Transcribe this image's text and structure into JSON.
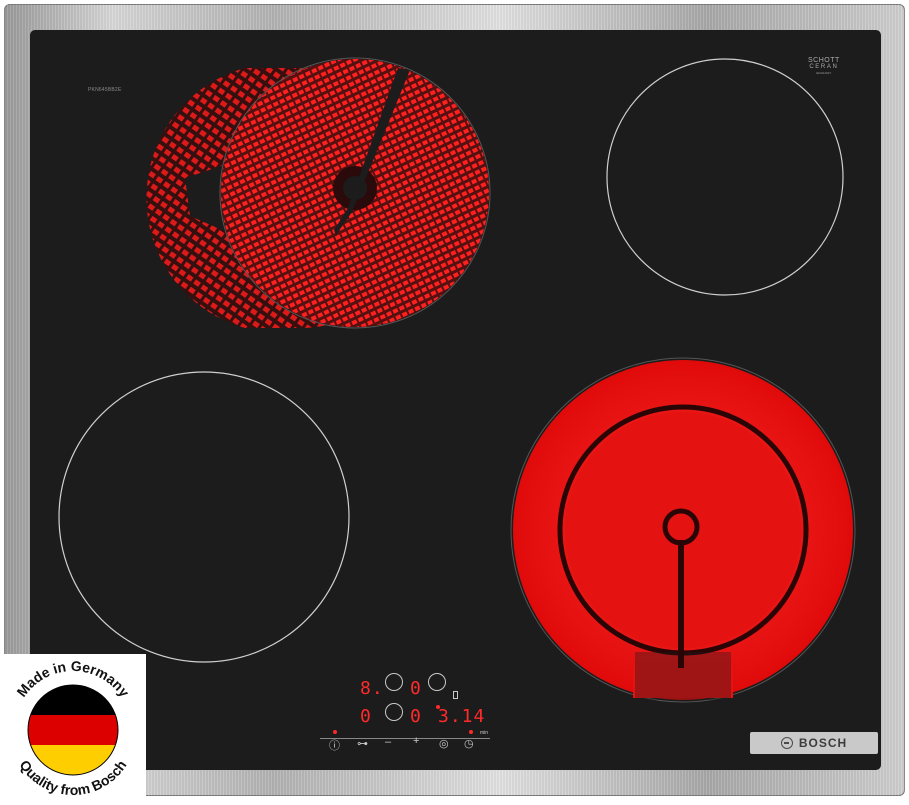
{
  "hob": {
    "model_number": "PKN645BB2E",
    "glass_brand_line1": "SCHOTT",
    "glass_brand_line2": "CERAN",
    "glass_brand_line3": "ECOLOGY",
    "display_left_top": "8.",
    "display_right_top": "0",
    "display_left_bottom": "0",
    "display_right_bottom": "0",
    "timer_value": "3.14",
    "timer_unit": "min",
    "controls": {
      "power": "ⓘ",
      "lock": "⊶",
      "minus": "–",
      "plus": "+",
      "zone_select": "◎",
      "timer": "◷"
    },
    "brand": "BOSCH"
  },
  "badge": {
    "text_top": "Made in Germany",
    "text_bottom": "Quality from Bosch",
    "flag_colors": [
      "#000000",
      "#dd0000",
      "#ffce00"
    ]
  },
  "colors": {
    "glass": "#1c1c1c",
    "glow": "#ff1a1a",
    "display": "#ff2a2a"
  }
}
